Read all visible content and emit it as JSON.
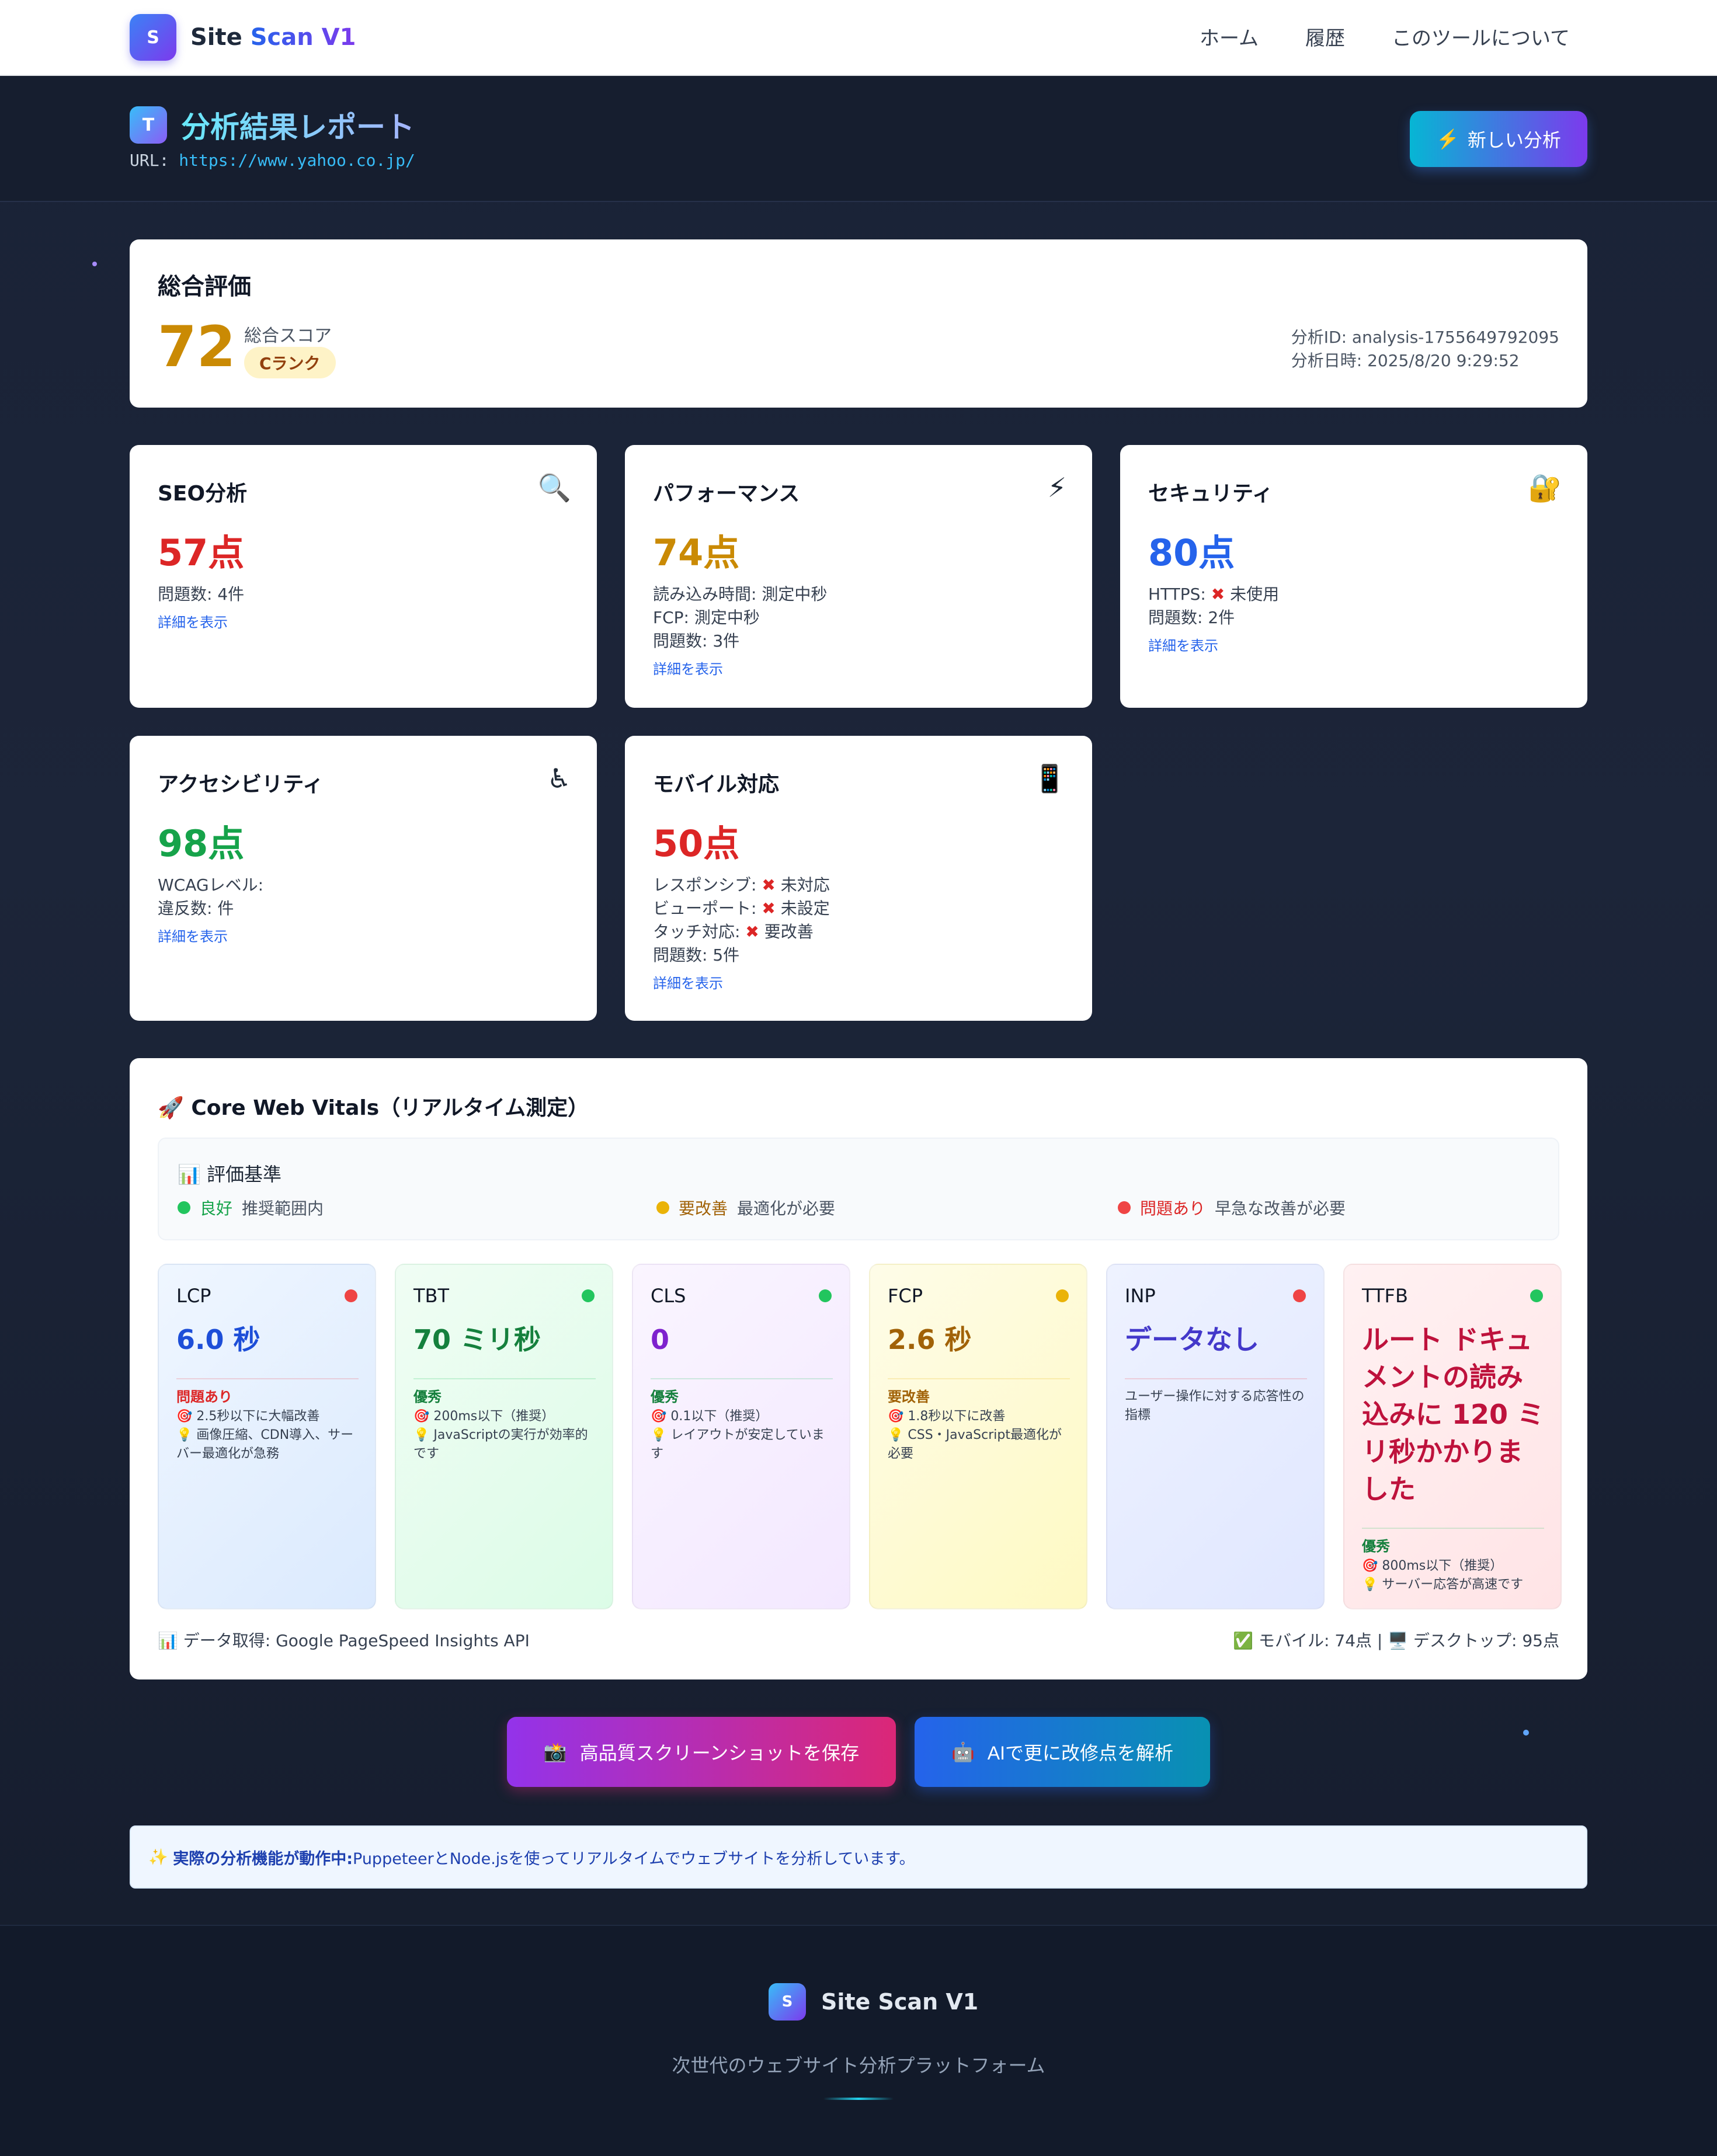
{
  "nav": {
    "logo_letter": "S",
    "brand_site": "Site",
    "brand_rest": "Scan V1",
    "links": [
      "ホーム",
      "履歴",
      "このツールについて"
    ]
  },
  "report": {
    "badge_letter": "T",
    "title": "分析結果レポート",
    "url_label": "URL:",
    "url": "https://www.yahoo.co.jp/",
    "new_button_icon": "⚡",
    "new_button_label": "新しい分析"
  },
  "overall": {
    "title": "総合評価",
    "score": "72",
    "score_label": "総合スコア",
    "rank": "Cランク",
    "analysis_id": "分析ID: analysis-1755649792095",
    "analysis_date": "分析日時: 2025/8/20 9:29:52"
  },
  "metrics": {
    "seo": {
      "title": "SEO分析",
      "icon": "🔍",
      "score": "57点",
      "color": "#dc2626",
      "lines": [
        "問題数: 4件"
      ],
      "link": "詳細を表示"
    },
    "performance": {
      "title": "パフォーマンス",
      "icon": "⚡",
      "score": "74点",
      "color": "#ca8a04",
      "lines": [
        "読み込み時間: 測定中秒",
        "FCP: 測定中秒",
        "問題数: 3件"
      ],
      "link": "詳細を表示"
    },
    "security": {
      "title": "セキュリティ",
      "icon": "🔐",
      "score": "80点",
      "color": "#2563eb",
      "https_label": "HTTPS:",
      "https_value": "未使用",
      "lines": [
        "問題数: 2件"
      ],
      "link": "詳細を表示"
    },
    "accessibility": {
      "title": "アクセシビリティ",
      "icon": "♿",
      "score": "98点",
      "color": "#16a34a",
      "lines": [
        "WCAGレベル:",
        "違反数: 件"
      ],
      "link": "詳細を表示"
    },
    "mobile": {
      "title": "モバイル対応",
      "icon": "📱",
      "score": "50点",
      "color": "#dc2626",
      "responsive_label": "レスポンシブ:",
      "responsive_value": "未対応",
      "viewport_label": "ビューポート:",
      "viewport_value": "未設定",
      "touch_label": "タッチ対応:",
      "touch_value": "要改善",
      "issues": "問題数: 5件",
      "link": "詳細を表示"
    }
  },
  "cwv": {
    "title": "🚀 Core Web Vitals（リアルタイム測定）",
    "criteria_title": "📊 評価基準",
    "criteria": [
      {
        "label": "良好",
        "desc": "推奨範囲内",
        "color": "#22c55e",
        "text_color": "#16a34a"
      },
      {
        "label": "要改善",
        "desc": "最適化が必要",
        "color": "#eab308",
        "text_color": "#a16207"
      },
      {
        "label": "問題あり",
        "desc": "早急な改善が必要",
        "color": "#ef4444",
        "text_color": "#dc2626"
      }
    ],
    "vitals": [
      {
        "name": "LCP",
        "value": "6.0 秒",
        "status": "問題あり",
        "target": "🎯 2.5秒以下に大幅改善",
        "tip": "💡 画像圧縮、CDN導入、サーバー最適化が急務",
        "dot": "#ef4444",
        "value_color": "#1d4ed8",
        "status_color": "#dc2626",
        "bg": "linear-gradient(135deg,#eff6ff,#dbeafe)"
      },
      {
        "name": "TBT",
        "value": "70 ミリ秒",
        "status": "優秀",
        "target": "🎯 200ms以下（推奨）",
        "tip": "💡 JavaScriptの実行が効率的です",
        "dot": "#22c55e",
        "value_color": "#15803d",
        "status_color": "#15803d",
        "bg": "linear-gradient(135deg,#f0fdf4,#dcfce7)"
      },
      {
        "name": "CLS",
        "value": "0",
        "status": "優秀",
        "target": "🎯 0.1以下（推奨）",
        "tip": "💡 レイアウトが安定しています",
        "dot": "#22c55e",
        "value_color": "#7e22ce",
        "status_color": "#15803d",
        "bg": "linear-gradient(135deg,#faf5ff,#f3e8ff)"
      },
      {
        "name": "FCP",
        "value": "2.6 秒",
        "status": "要改善",
        "target": "🎯 1.8秒以下に改善",
        "tip": "💡 CSS・JavaScript最適化が必要",
        "dot": "#eab308",
        "value_color": "#a16207",
        "status_color": "#a16207",
        "bg": "linear-gradient(135deg,#fefce8,#fef9c3)"
      },
      {
        "name": "INP",
        "value": "データなし",
        "status": "",
        "target": "ユーザー操作に対する応答性の指標",
        "tip": "",
        "dot": "#ef4444",
        "value_color": "#4338ca",
        "status_color": "#4b5563",
        "bg": "linear-gradient(135deg,#eef2ff,#e0e7ff)"
      },
      {
        "name": "TTFB",
        "value": "ルート ドキュメントの読み込みに 120 ミリ秒かかりました",
        "status": "優秀",
        "target": "🎯 800ms以下（推奨）",
        "tip": "💡 サーバー応答が高速です",
        "dot": "#22c55e",
        "value_color": "#be123c",
        "status_color": "#15803d",
        "bg": "linear-gradient(135deg,#fff1f2,#ffe4e6)"
      }
    ],
    "source": "📊 データ取得: Google PageSpeed Insights API",
    "scores": "✅ モバイル: 74点 | 🖥️ デスクトップ: 95点"
  },
  "actions": {
    "screenshot_icon": "📸",
    "screenshot_label": "高品質スクリーンショットを保存",
    "ai_icon": "🤖",
    "ai_label": "AIで更に改修点を解析"
  },
  "notice": {
    "icon": "✨",
    "bold": "実際の分析機能が動作中:",
    "text": " PuppeteerとNode.jsを使ってリアルタイムでウェブサイトを分析しています。"
  },
  "footer": {
    "logo_letter": "S",
    "name": "Site Scan V1",
    "tagline": "次世代のウェブサイト分析プラットフォーム"
  }
}
